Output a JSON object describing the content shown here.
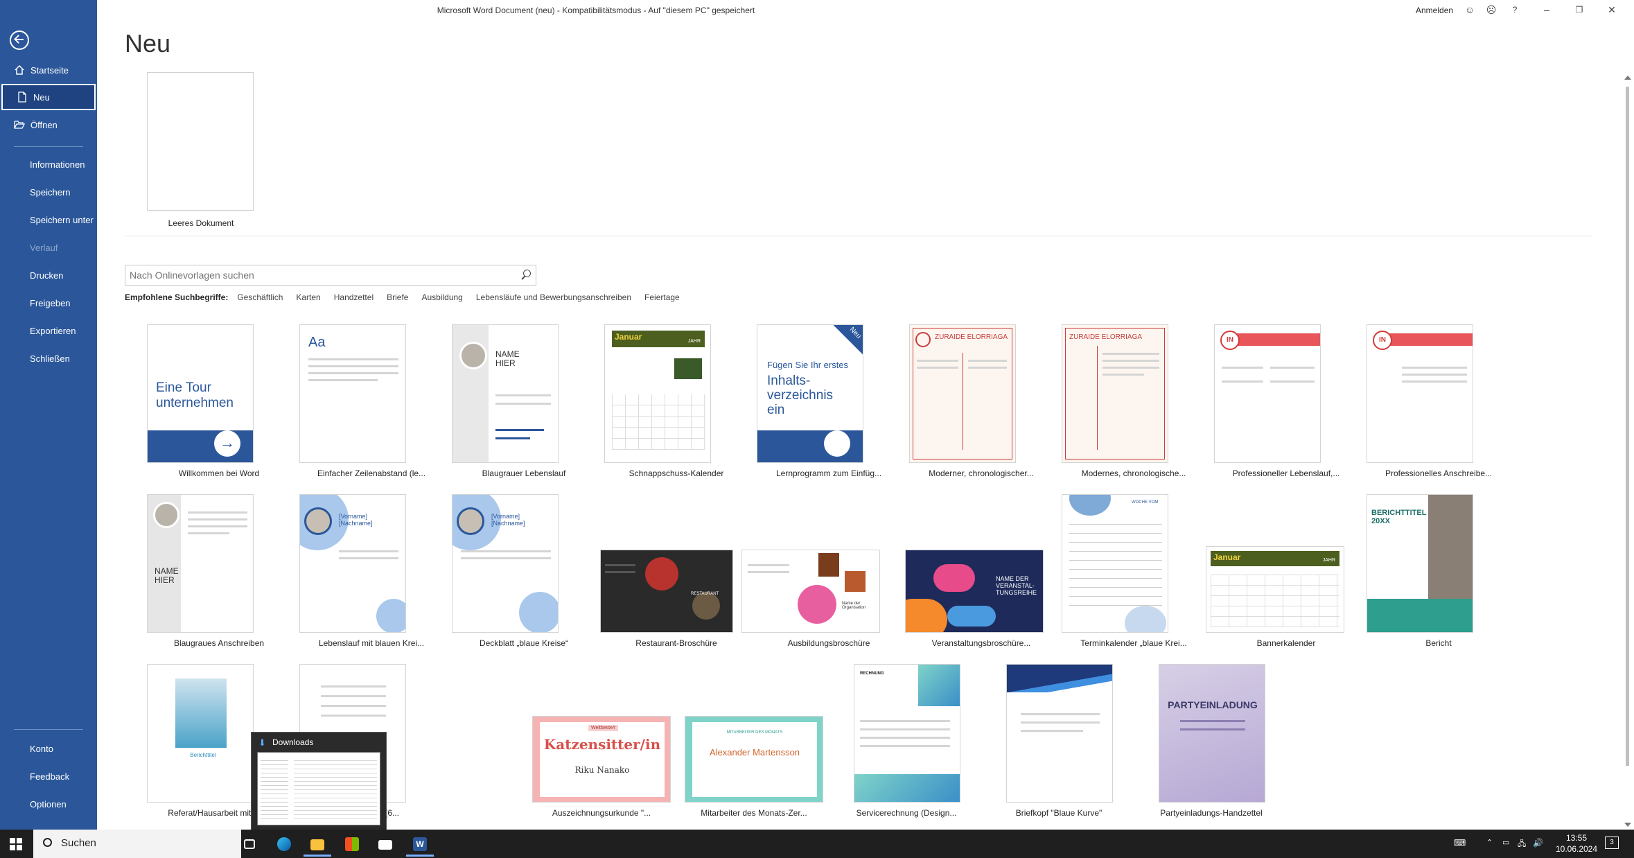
{
  "window": {
    "title": "Microsoft Word Document (neu)  -  Kompatibilitätsmodus  -  Auf \"diesem PC\" gespeichert",
    "signin": "Anmelden"
  },
  "sidebar": {
    "top": [
      {
        "label": "Startseite"
      },
      {
        "label": "Neu"
      },
      {
        "label": "Öffnen"
      }
    ],
    "middle": [
      {
        "label": "Informationen"
      },
      {
        "label": "Speichern"
      },
      {
        "label": "Speichern unter"
      },
      {
        "label": "Verlauf"
      },
      {
        "label": "Drucken"
      },
      {
        "label": "Freigeben"
      },
      {
        "label": "Exportieren"
      },
      {
        "label": "Schließen"
      }
    ],
    "bottom": [
      {
        "label": "Konto"
      },
      {
        "label": "Feedback"
      },
      {
        "label": "Optionen"
      }
    ]
  },
  "page": {
    "title": "Neu",
    "blank_label": "Leeres Dokument"
  },
  "search": {
    "placeholder": "Nach Onlinevorlagen suchen"
  },
  "suggested": {
    "label": "Empfohlene Suchbegriffe:",
    "terms": [
      "Geschäftlich",
      "Karten",
      "Handzettel",
      "Briefe",
      "Ausbildung",
      "Lebensläufe und Bewerbungsanschreiben",
      "Feiertage"
    ]
  },
  "templates": [
    {
      "label": "Willkommen bei Word",
      "text": "Eine Tour unternehmen"
    },
    {
      "label": "Einfacher Zeilenabstand (le...",
      "text": "Aa"
    },
    {
      "label": "Blaugrauer Lebenslauf",
      "text": "NAME HIER"
    },
    {
      "label": "Schnappschuss-Kalender",
      "text": "Januar",
      "text2": "JAHR"
    },
    {
      "label": "Lernprogramm zum Einfüg...",
      "text": "Fügen Sie Ihr erstes",
      "text2": "Inhalts-verzeichnis ein",
      "badge": "Neu"
    },
    {
      "label": "Moderner, chronologischer...",
      "text": "ZURAIDE ELORRIAGA"
    },
    {
      "label": "Modernes, chronologische...",
      "text": "ZURAIDE ELORRIAGA"
    },
    {
      "label": "Professioneller Lebenslauf,...",
      "text": "IN"
    },
    {
      "label": "Professionelles Anschreibe...",
      "text": "IN"
    },
    {
      "label": "Blaugraues Anschreiben",
      "text": "NAME HIER"
    },
    {
      "label": "Lebenslauf mit blauen Krei...",
      "text": "[Vorname] [Nachname]"
    },
    {
      "label": "Deckblatt „blaue Kreise“",
      "text": "[Vorname] [Nachname]"
    },
    {
      "label": "Restaurant-Broschüre",
      "text": "RESTAURANT"
    },
    {
      "label": "Ausbildungsbroschüre",
      "text": "Name der Organisation"
    },
    {
      "label": "Veranstaltungsbroschüre...",
      "text": "NAME DER VERANSTAL-TUNGSREIHE"
    },
    {
      "label": "Terminkalender „blaue Krei...",
      "text": "WOCHE VOM"
    },
    {
      "label": "Bannerkalender",
      "text": "Januar",
      "text2": "JAHR"
    },
    {
      "label": "Bericht",
      "text": "BERICHTTITEL 20XX"
    },
    {
      "label": "Referat/Hausarbeit mit Foto",
      "text": "Berichttitel"
    },
    {
      "label": "(6...",
      "text": ""
    },
    {
      "label": "Auszeichnungsurkunde \"...",
      "text": "Katzensitter/in",
      "text2": "Riku Nanako",
      "text3": "Weltbeste/r"
    },
    {
      "label": "Mitarbeiter des Monats-Zer...",
      "text": "Alexander Martensson",
      "text2": "MITARBEITER DES MONATS"
    },
    {
      "label": "Servicerechnung (Design...",
      "text": "RECHNUNG"
    },
    {
      "label": "Briefkopf \"Blaue Kurve\"",
      "text": ""
    },
    {
      "label": "Partyeinladungs-Handzettel",
      "text": "PARTYEINLADUNG"
    }
  ],
  "popup": {
    "title": "Downloads"
  },
  "taskbar": {
    "search": "Suchen",
    "time": "13:55",
    "date": "10.06.2024",
    "notifications": "3"
  },
  "colors": {
    "word_blue": "#2b579a",
    "taskbar": "#1f1f1f"
  }
}
